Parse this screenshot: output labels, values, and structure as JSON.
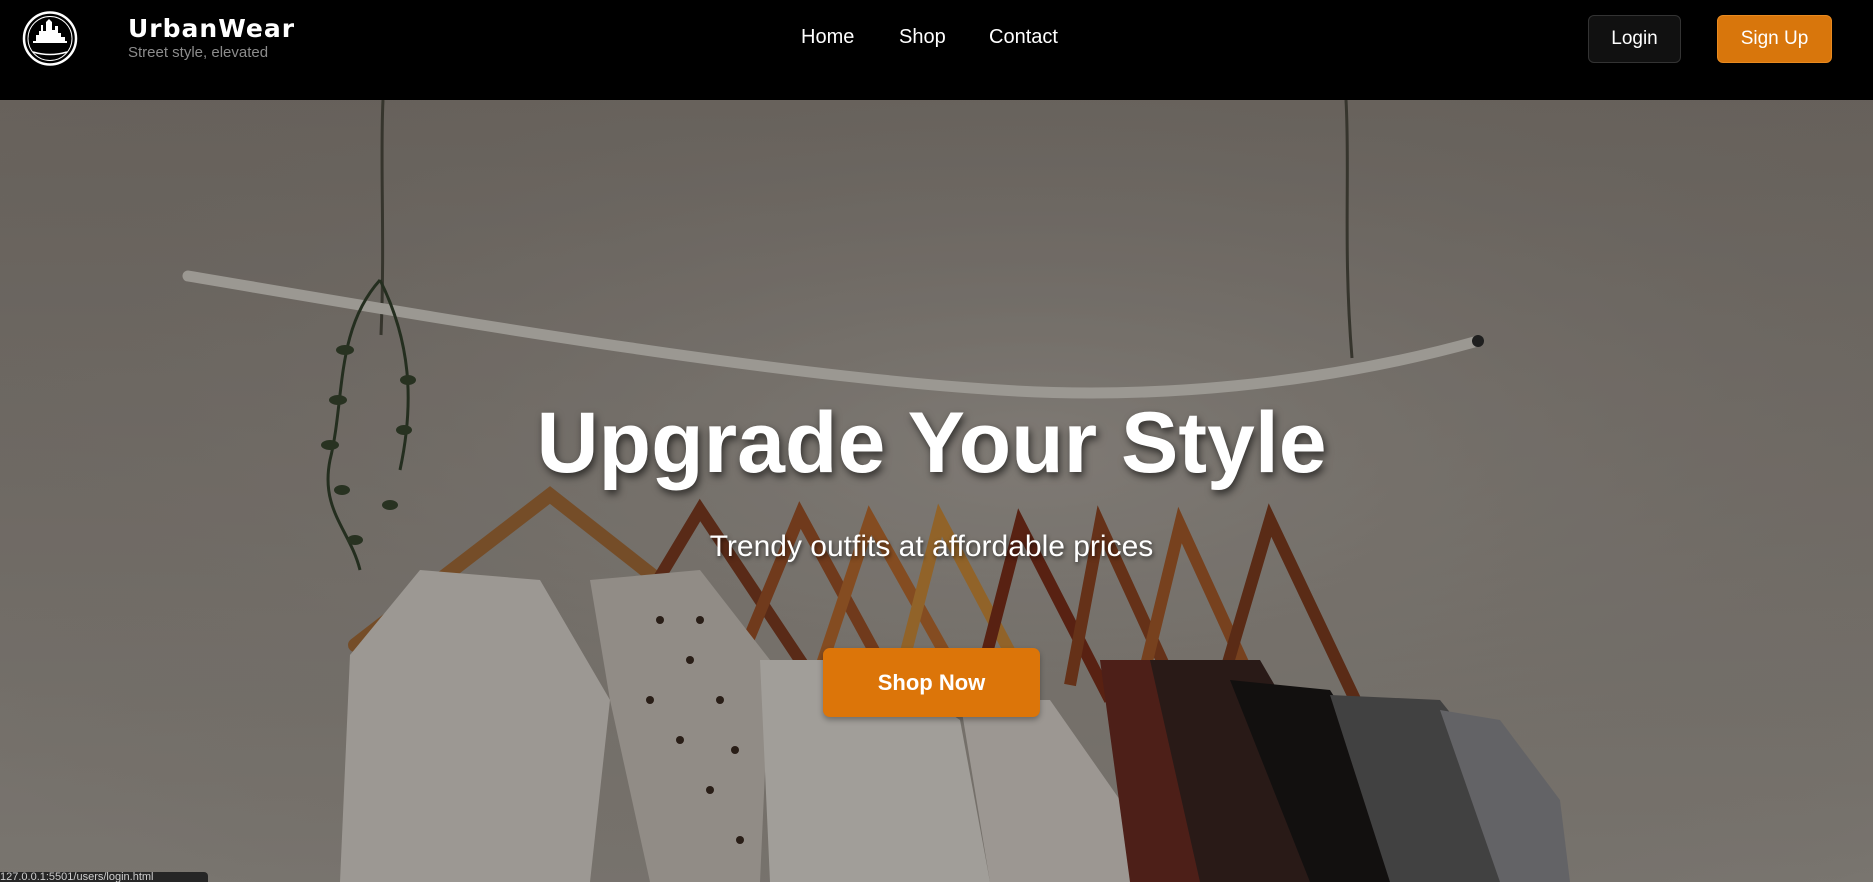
{
  "brand": {
    "name": "UrbanWear",
    "tagline": "Street style, elevated",
    "logo_text": "URBANWEAR"
  },
  "nav": {
    "items": [
      {
        "label": "Home"
      },
      {
        "label": "Shop"
      },
      {
        "label": "Contact"
      }
    ]
  },
  "auth": {
    "login_label": "Login",
    "signup_label": "Sign Up"
  },
  "hero": {
    "title": "Upgrade Your Style",
    "subtitle": "Trendy outfits at affordable prices",
    "cta_label": "Shop Now"
  },
  "status_bar": {
    "url": "127.0.0.1:5501/users/login.html"
  },
  "colors": {
    "accent": "#dc7509",
    "header_bg": "#000000",
    "text": "#ffffff"
  }
}
